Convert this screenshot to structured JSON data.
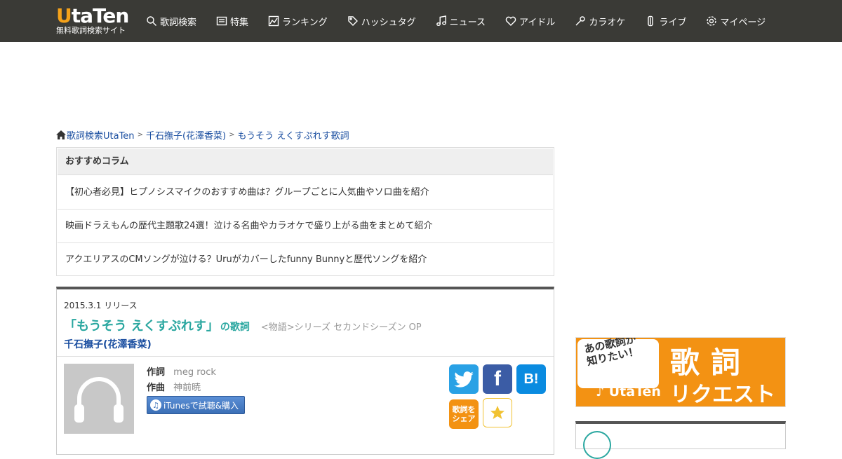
{
  "header": {
    "logo_main_u": "U",
    "logo_main_rest": "taTen",
    "logo_sub": "無料歌詞検索サイト",
    "nav": [
      {
        "label": "歌詞検索",
        "icon": "search-icon"
      },
      {
        "label": "特集",
        "icon": "feature-icon"
      },
      {
        "label": "ランキング",
        "icon": "ranking-icon"
      },
      {
        "label": "ハッシュタグ",
        "icon": "tag-icon"
      },
      {
        "label": "ニュース",
        "icon": "music-note-icon"
      },
      {
        "label": "アイドル",
        "icon": "heart-icon"
      },
      {
        "label": "カラオケ",
        "icon": "microphone-icon"
      },
      {
        "label": "ライブ",
        "icon": "guitar-icon"
      },
      {
        "label": "マイページ",
        "icon": "gear-icon"
      }
    ]
  },
  "breadcrumb": {
    "home": "歌詞検索UtaTen",
    "sep": ">",
    "artist": "千石撫子(花澤香菜)",
    "current": "もうそう えくすぷれす歌詞"
  },
  "column": {
    "title": "おすすめコラム",
    "items": [
      "【初心者必見】ヒプノシスマイクのおすすめ曲は？グループごとに人気曲やソロ曲を紹介",
      "映画ドラえもんの歴代主題歌24選！泣ける名曲やカラオケで盛り上がる曲をまとめて紹介",
      "アクエリアスのCMソングが泣ける？Uruがカバーしたfunny Bunnyと歴代ソングを紹介"
    ]
  },
  "song": {
    "release": "2015.3.1 リリース",
    "title": "「もうそう えくすぷれす」",
    "title_suffix": "の歌詞",
    "tie_in": "<物語>シリーズ セカンドシーズン OP",
    "artist": "千石撫子(花澤香菜)",
    "lyricist_label": "作詞",
    "lyricist": "meg rock",
    "composer_label": "作曲",
    "composer": "神前暁",
    "itunes_label": "iTunesで試聴&購入",
    "facebook_glyph": "f",
    "hatena_glyph": "B!",
    "line_share_label": "歌詞を\nシェア"
  },
  "banner": {
    "bubble": "あの歌詞が\n知りたい！",
    "logo": "♪ UtaTen",
    "big": "歌詞",
    "small": "リクエスト"
  },
  "colors": {
    "header_bg": "#3a3a36",
    "accent_orange": "#f39213",
    "title_teal": "#2aa7a0",
    "link_blue": "#1a4ea0"
  }
}
